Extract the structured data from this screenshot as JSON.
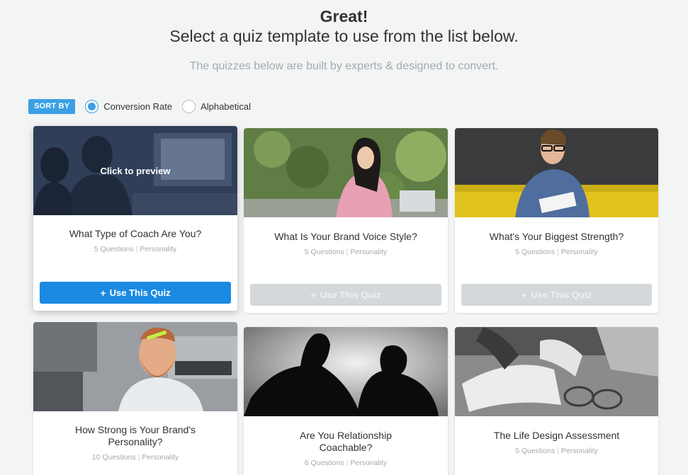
{
  "header": {
    "great": "Great!",
    "select": "Select a quiz template to use from the list below.",
    "subtitle": "The quizzes below are built by experts & designed to convert."
  },
  "sort": {
    "badge": "SORT BY",
    "options": [
      {
        "label": "Conversion Rate",
        "checked": true
      },
      {
        "label": "Alphabetical",
        "checked": false
      }
    ]
  },
  "accent_color": "#1a8ae3",
  "cards": [
    {
      "title": "What Type of Coach Are You?",
      "questions": "5 Questions",
      "category": "Personality",
      "button": "Use This Quiz",
      "overlay": "Click to preview",
      "state": "hover"
    },
    {
      "title": "What Is Your Brand Voice Style?",
      "questions": "5 Questions",
      "category": "Personality",
      "button": "Use This Quiz",
      "state": "normal"
    },
    {
      "title": "What's Your Biggest Strength?",
      "questions": "5 Questions",
      "category": "Personality",
      "button": "Use This Quiz",
      "state": "normal"
    },
    {
      "title": "How Strong is Your Brand's Personality?",
      "questions": "10 Questions",
      "category": "Personality"
    },
    {
      "title": "Are You Relationship Coachable?",
      "questions": "6 Questions",
      "category": "Personality"
    },
    {
      "title": "The Life Design Assessment",
      "questions": "5 Questions",
      "category": "Personality"
    }
  ]
}
